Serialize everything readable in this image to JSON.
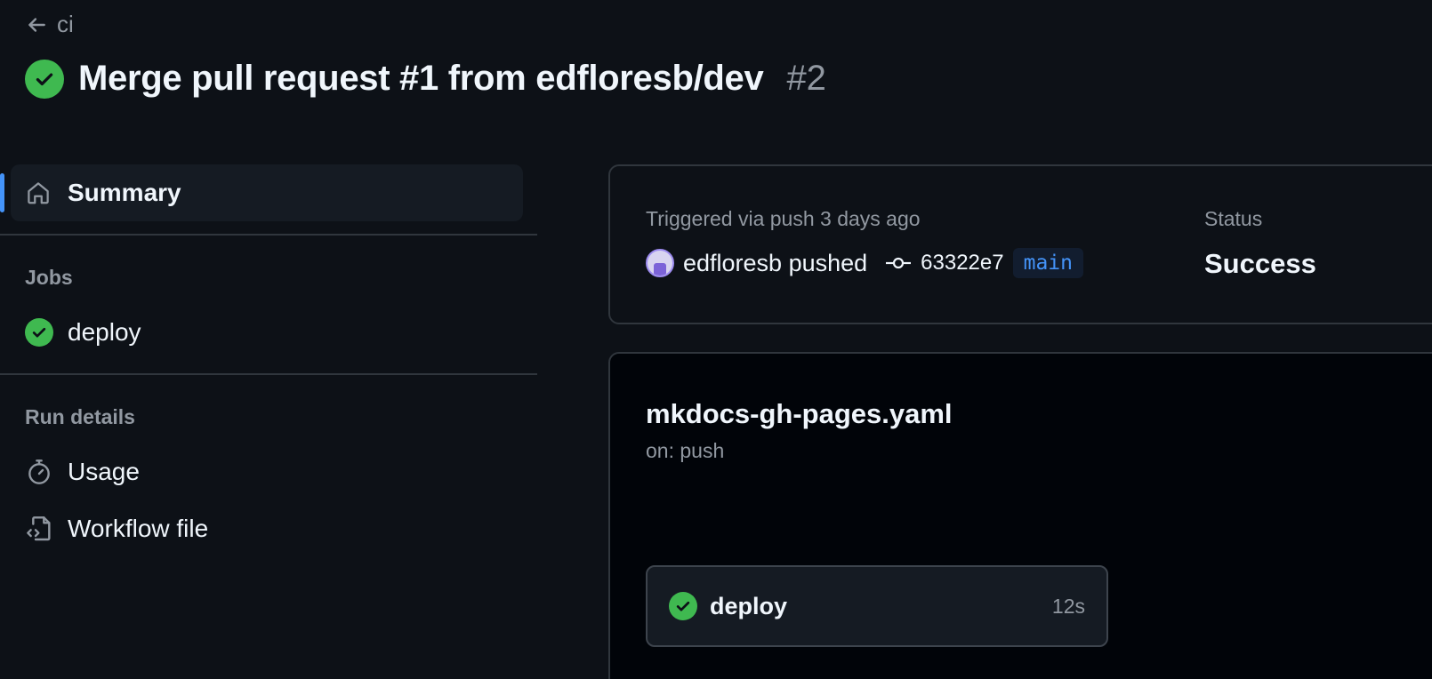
{
  "header": {
    "back_label": "ci",
    "title": "Merge pull request #1 from edfloresb/dev",
    "run_number": "#2"
  },
  "sidebar": {
    "summary_label": "Summary",
    "jobs_heading": "Jobs",
    "jobs": [
      {
        "label": "deploy"
      }
    ],
    "run_details_heading": "Run details",
    "run_details": [
      {
        "label": "Usage"
      },
      {
        "label": "Workflow file"
      }
    ]
  },
  "trigger": {
    "label": "Triggered via push 3 days ago",
    "actor": "edfloresb pushed",
    "commit_sha": "63322e7",
    "branch": "main",
    "status_label": "Status",
    "status_value": "Success"
  },
  "workflow": {
    "file_name": "mkdocs-gh-pages.yaml",
    "trigger": "on: push",
    "job": {
      "name": "deploy",
      "duration": "12s"
    }
  },
  "colors": {
    "background": "#0d1117",
    "success": "#3fb950",
    "accent": "#4493f8",
    "muted": "#9198a1",
    "border": "#30363d"
  },
  "icons": {
    "back": "arrow-left-icon",
    "status": "check-circle-icon",
    "summary": "home-icon",
    "usage": "stopwatch-icon",
    "workflow_file": "file-code-icon",
    "commit": "git-commit-icon"
  }
}
